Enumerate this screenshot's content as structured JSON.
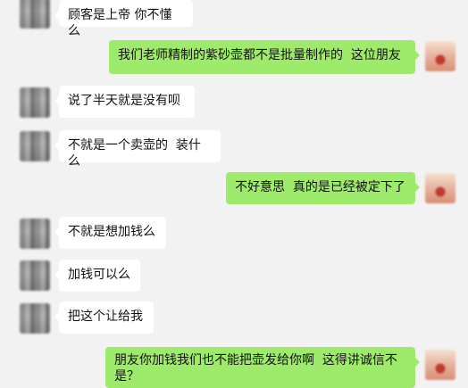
{
  "chat": {
    "messages": [
      {
        "side": "left",
        "text": "顾客是上帝 你不懂么"
      },
      {
        "side": "right",
        "text": "我们老师精制的紫砂壶都不是批量制作的  这位朋友"
      },
      {
        "side": "left",
        "text": "说了半天就是没有呗"
      },
      {
        "side": "left",
        "text": "不就是一个卖壶的  装什么"
      },
      {
        "side": "right",
        "text": "不好意思  真的是已经被定下了"
      },
      {
        "side": "left",
        "text": "不就是想加钱么"
      },
      {
        "side": "left",
        "text": "加钱可以么"
      },
      {
        "side": "left",
        "text": "把这个让给我"
      },
      {
        "side": "right",
        "text": "朋友你加钱我们也不能把壶发给你啊  这得讲诚信不是？"
      }
    ]
  },
  "colors": {
    "background": "#f2f2f2",
    "incoming_bubble": "#ffffff",
    "outgoing_bubble": "#9eea6a"
  }
}
